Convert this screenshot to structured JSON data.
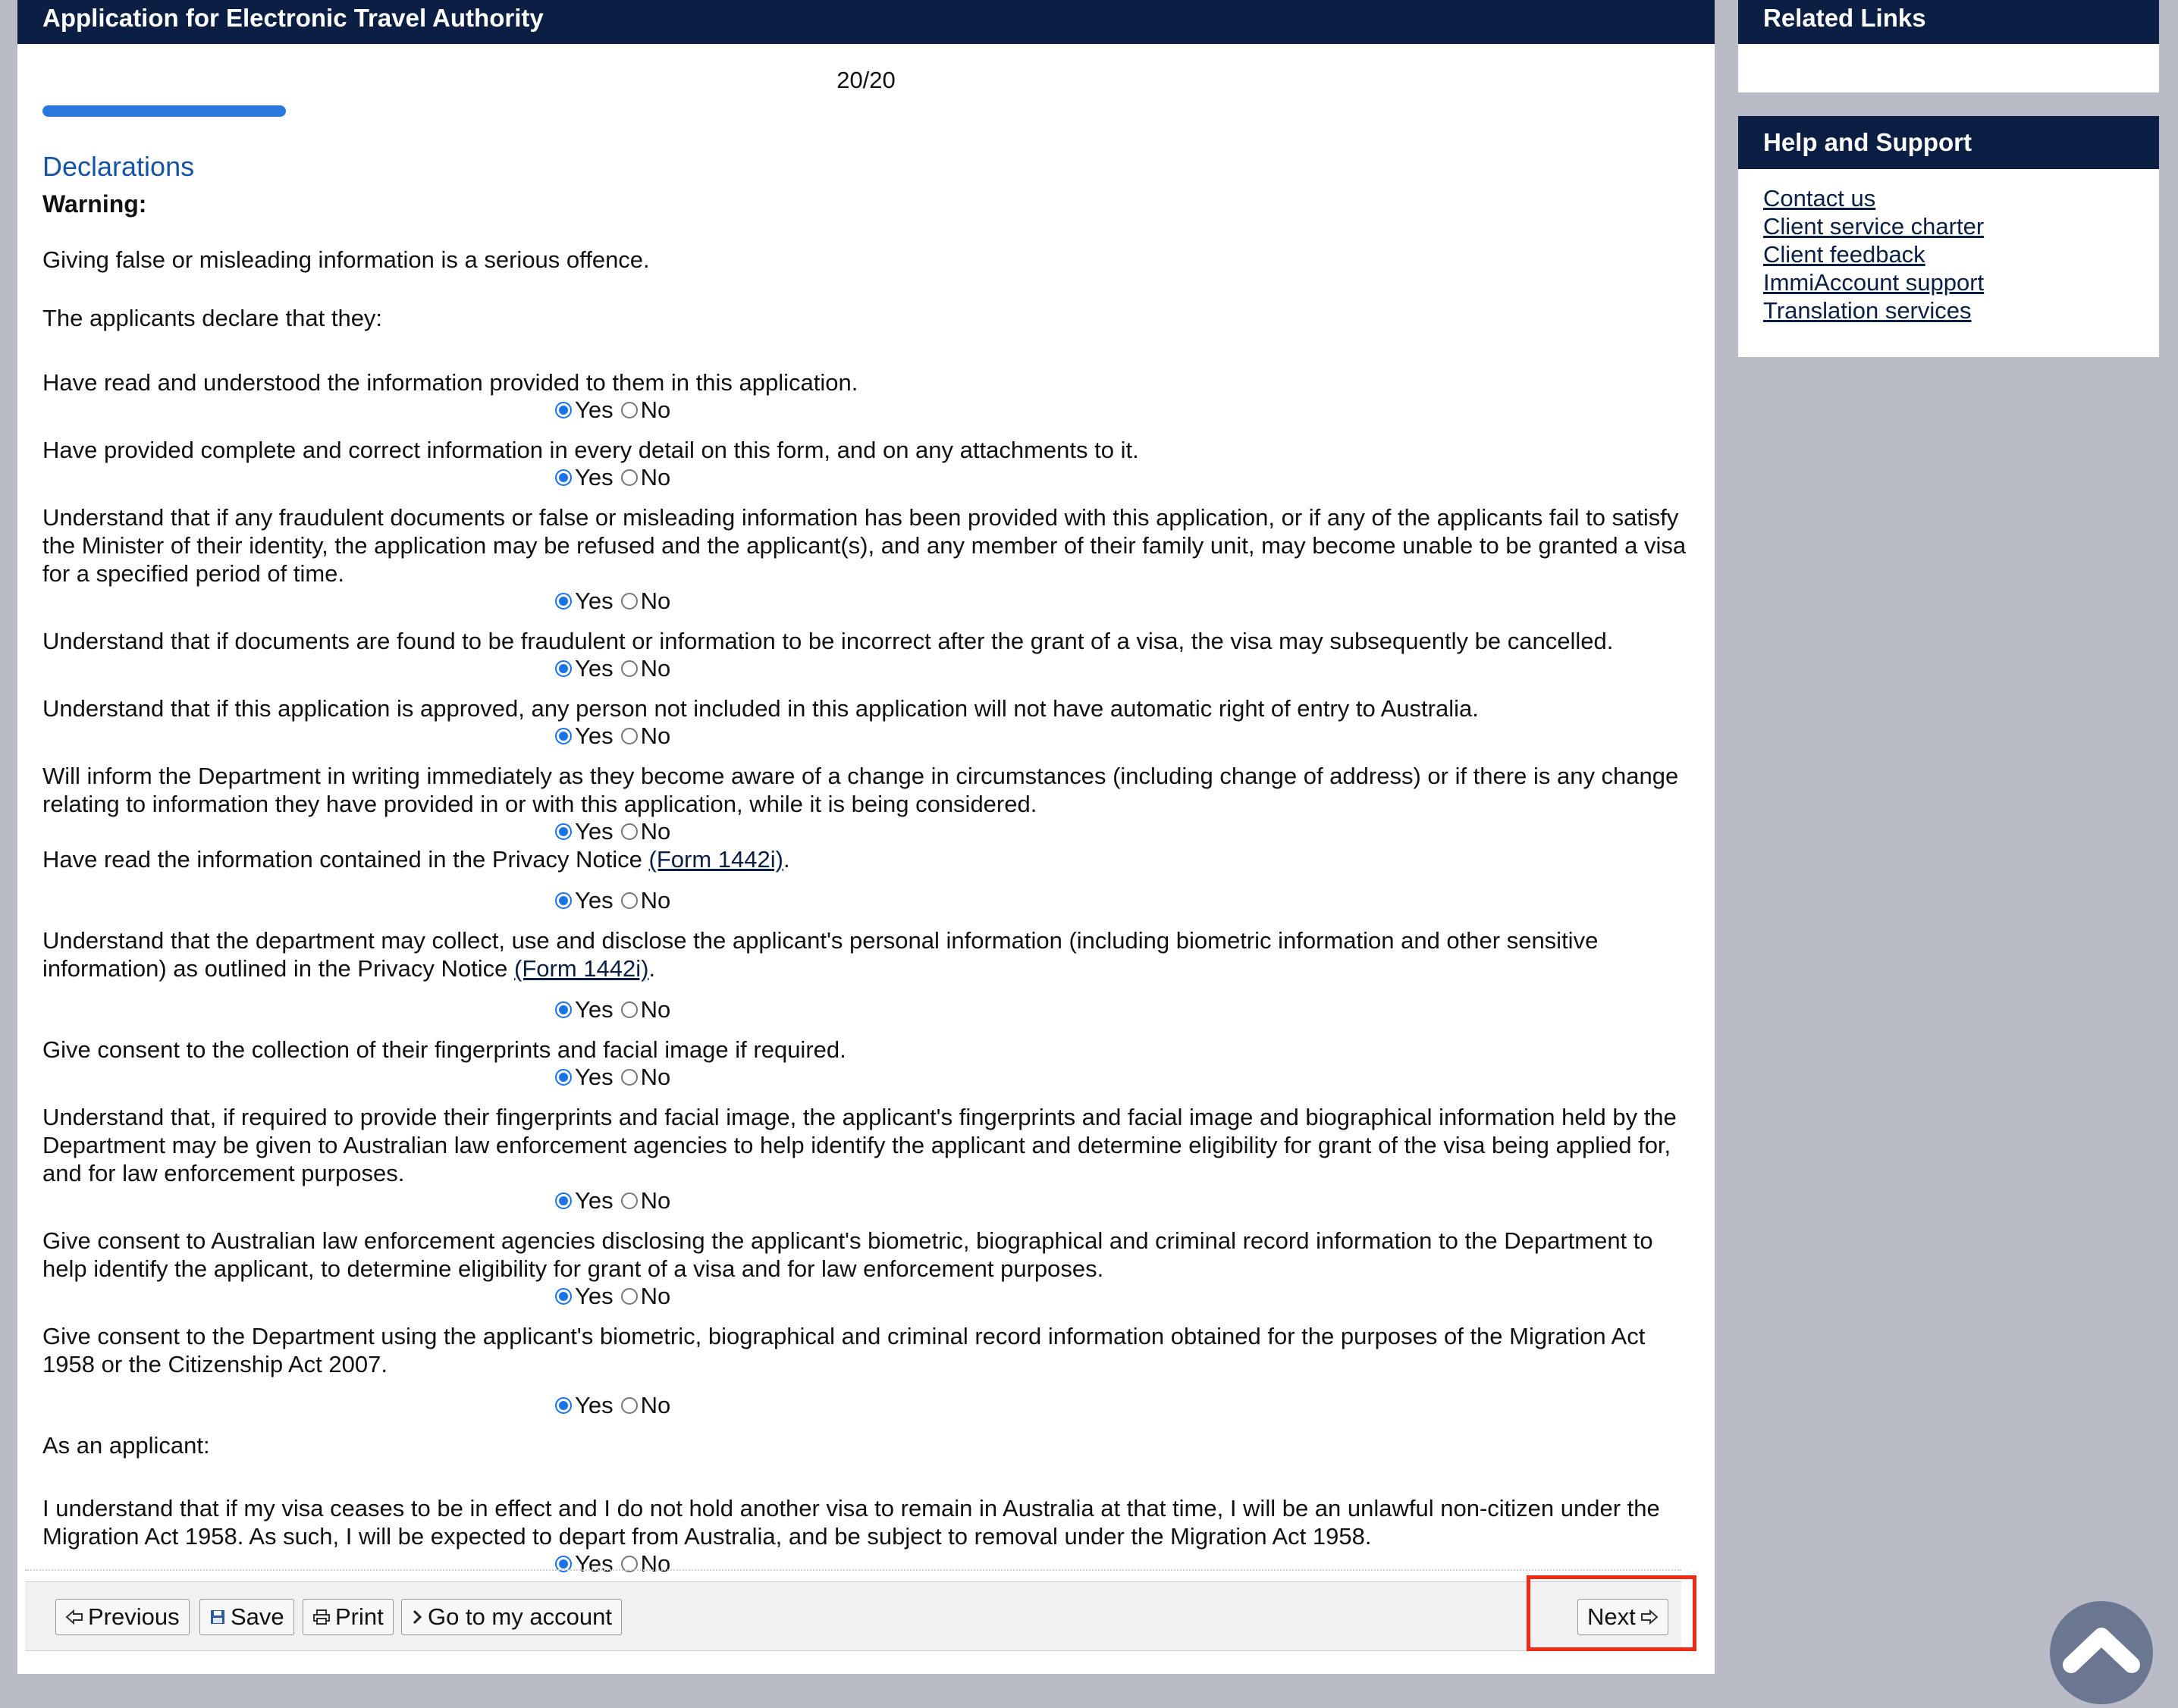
{
  "header": {
    "title": "Application for Electronic Travel Authority"
  },
  "progress": {
    "page_count": "20/20",
    "fraction": 1.0
  },
  "section": {
    "title": "Declarations",
    "warning_label": "Warning:",
    "intro_1": "Giving false or misleading information is a serious offence.",
    "intro_2": "The applicants declare that they:",
    "applicant_heading": "As an applicant:"
  },
  "radio_labels": {
    "yes": "Yes",
    "no": "No"
  },
  "questions": [
    {
      "text": "Have read and understood the information provided to them in this application.",
      "selected": "Yes"
    },
    {
      "text": "Have provided complete and correct information in every detail on this form, and on any attachments to it.",
      "selected": "Yes"
    },
    {
      "text": "Understand that if any fraudulent documents or false or misleading information has been provided with this application, or if any of the applicants fail to satisfy the Minister of their identity, the application may be refused and the applicant(s), and any member of their family unit, may become unable to be granted a visa for a specified period of time.",
      "selected": "Yes"
    },
    {
      "text": "Understand that if documents are found to be fraudulent or information to be incorrect after the grant of a visa, the visa may subsequently be cancelled.",
      "selected": "Yes"
    },
    {
      "text": "Understand that if this application is approved, any person not included in this application will not have automatic right of entry to Australia.",
      "selected": "Yes"
    },
    {
      "text": "Will inform the Department in writing immediately as they become aware of a change in circumstances (including change of address) or if there is any change relating to information they have provided in or with this application, while it is being considered.",
      "selected": "Yes"
    },
    {
      "text_before": "Have read the information contained in the Privacy Notice ",
      "link": "(Form 1442i)",
      "text_after": ".",
      "selected": "Yes"
    },
    {
      "text_before": "Understand that the department may collect, use and disclose the applicant's personal information (including biometric information and other sensitive information) as outlined in the Privacy Notice ",
      "link": "(Form 1442i)",
      "text_after": ".",
      "selected": "Yes"
    },
    {
      "text": "Give consent to the collection of their fingerprints and facial image if required.",
      "selected": "Yes"
    },
    {
      "text": "Understand that, if required to provide their fingerprints and facial image, the applicant's fingerprints and facial image and biographical information held by the Department may be given to Australian law enforcement agencies to help identify the applicant and determine eligibility for grant of the visa being applied for, and for law enforcement purposes.",
      "selected": "Yes"
    },
    {
      "text": "Give consent to Australian law enforcement agencies disclosing the applicant's biometric, biographical and criminal record information to the Department to help identify the applicant, to determine eligibility for grant of a visa and for law enforcement purposes.",
      "selected": "Yes"
    },
    {
      "text": "Give consent to the Department using the applicant's biometric, biographical and criminal record information obtained for the purposes of the Migration Act 1958 or the Citizenship Act 2007.",
      "selected": "Yes"
    },
    {
      "text": "I understand that if my visa ceases to be in effect and I do not hold another visa to remain in Australia at that time, I will be an unlawful non-citizen under the Migration Act 1958. As such, I will be expected to depart from Australia, and be subject to removal under the Migration Act 1958.",
      "selected": "Yes"
    }
  ],
  "toolbar": {
    "previous": "Previous",
    "save": "Save",
    "print": "Print",
    "account": "Go to my account",
    "next": "Next"
  },
  "sidebar": {
    "related_title": "Related Links",
    "help_title": "Help and Support",
    "help_links": [
      "Contact us",
      "Client service charter",
      "Client feedback",
      "ImmiAccount support",
      "Translation services"
    ]
  },
  "colors": {
    "header_bg": "#0b1f45",
    "accent": "#1a73e8",
    "highlight": "#ef2b14"
  }
}
